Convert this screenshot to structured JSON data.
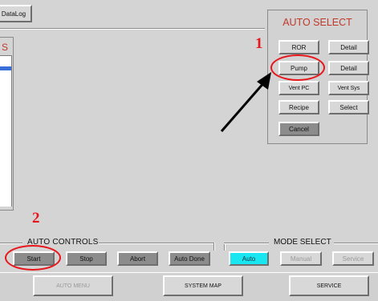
{
  "top_bar": {
    "datalog_label": "DataLog"
  },
  "left_panel": {
    "title_fragment": "S"
  },
  "auto_select": {
    "title": "AUTO SELECT",
    "buttons": {
      "ror": "ROR",
      "detail1": "Detail",
      "pump": "Pump",
      "detail2": "Detail",
      "vent_pc": "Vent PC",
      "vent_sys": "Vent Sys",
      "recipe": "Recipe",
      "select": "Select",
      "cancel": "Cancel"
    }
  },
  "auto_controls": {
    "title": "AUTO CONTROLS",
    "buttons": {
      "start": "Start",
      "stop": "Stop",
      "abort": "Abort",
      "auto_done": "Auto Done"
    }
  },
  "mode_select": {
    "title": "MODE SELECT",
    "buttons": {
      "auto": "Auto",
      "manual": "Manual",
      "service": "Service"
    }
  },
  "bottom_nav": {
    "auto_menu": "AUTO MENU",
    "system_map": "SYSTEM MAP",
    "service": "SERVICE"
  },
  "annotations": {
    "num1": "1",
    "num2": "2"
  },
  "colors": {
    "annotation_red": "#e8151a",
    "auto_selected": "#19e6f0",
    "panel_title": "#c0392b"
  }
}
